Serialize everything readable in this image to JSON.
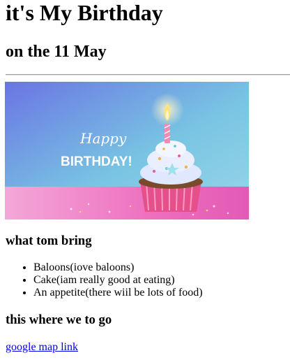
{
  "page": {
    "heading": "it's My Birthday",
    "subheading": "on the 11 May",
    "image": {
      "text_happy": "Happy",
      "text_birthday": "BIRTHDAY!",
      "colors": {
        "sky_top": "#5b7fe0",
        "sky_bottom": "#8fd3e6",
        "floor": "#f07ac7",
        "wrapper": "#e54f8a",
        "frosting": "#dfeaff"
      }
    },
    "bring": {
      "heading": "what tom bring",
      "items": [
        "Baloons(iove baloons)",
        "Cake(iam really good at eating)",
        "An appetite(there wiil be lots of food)"
      ]
    },
    "location": {
      "heading": "this where we to go",
      "link_text": "google map link",
      "link_color": "#0000ee"
    }
  }
}
